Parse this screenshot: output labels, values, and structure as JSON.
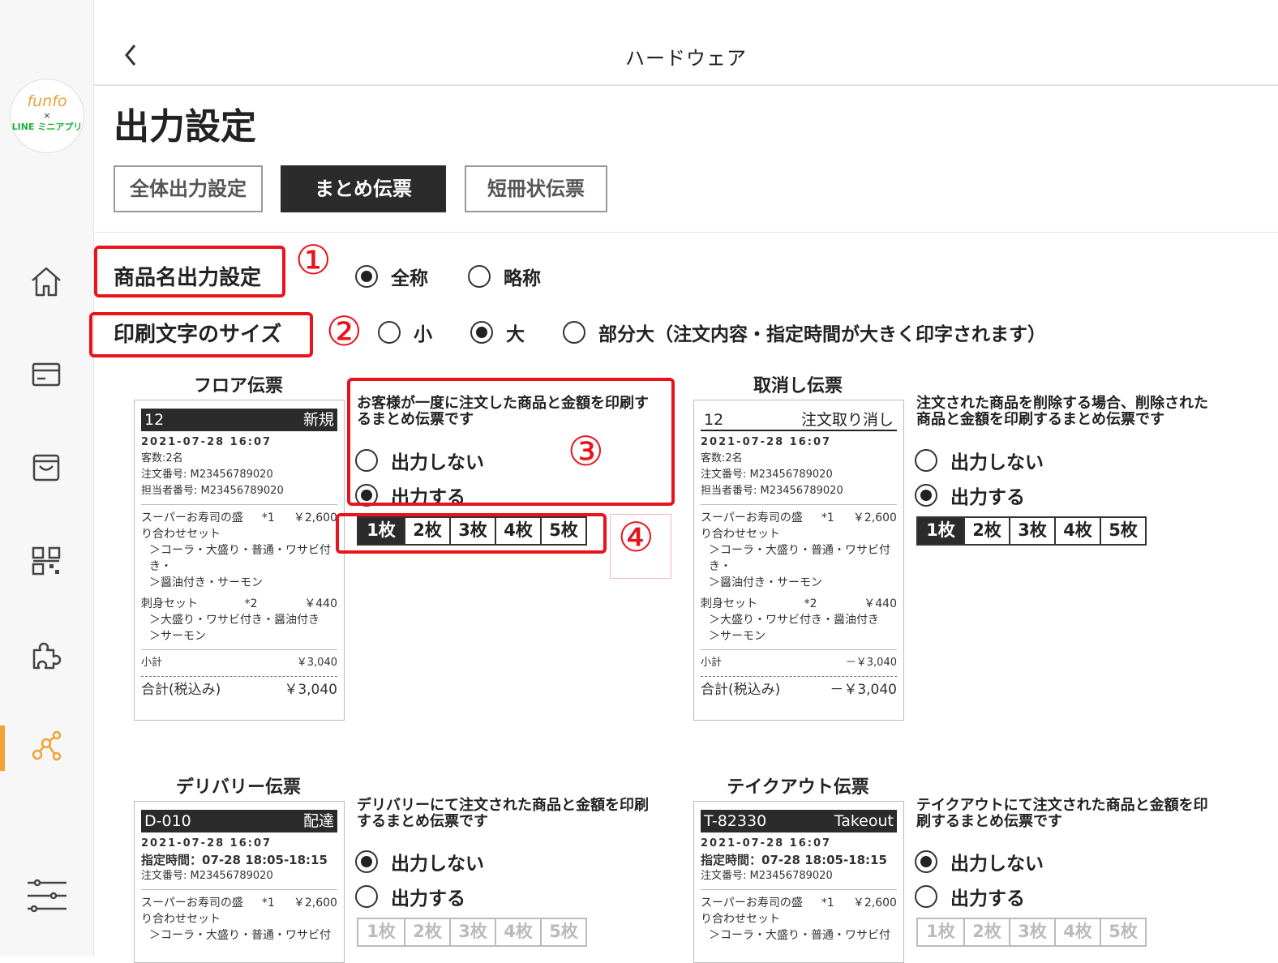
{
  "app": {
    "brand_line1": "funfo",
    "brand_line2": "×",
    "brand_line3": "LINE ミニアプリ"
  },
  "topbar": {
    "back_icon": "chevron-left-icon",
    "title": "ハードウェア"
  },
  "page": {
    "title": "出力設定"
  },
  "tabs": [
    {
      "label": "全体出力設定",
      "active": false
    },
    {
      "label": "まとめ伝票",
      "active": true
    },
    {
      "label": "短冊状伝票",
      "active": false
    }
  ],
  "annotations": {
    "n1": "①",
    "n2": "②",
    "n3": "③",
    "n4": "④",
    "color": "#e8131b"
  },
  "product_name": {
    "label": "商品名出力設定",
    "options": [
      {
        "label": "全称",
        "selected": true
      },
      {
        "label": "略称",
        "selected": false
      }
    ]
  },
  "font_size": {
    "label": "印刷文字のサイズ",
    "options": [
      {
        "label": "小",
        "selected": false
      },
      {
        "label": "大",
        "selected": true
      },
      {
        "label": "部分大（注文内容・指定時間が大きく印字されます）",
        "selected": false
      }
    ]
  },
  "copies": [
    "1枚",
    "2枚",
    "3枚",
    "4枚",
    "5枚"
  ],
  "floor": {
    "title": "フロア伝票",
    "desc_1": "お客様が一度に注文した商品と金額を印刷す",
    "desc_2": "るまとめ伝票です",
    "opt_off": "出力しない",
    "opt_on": "出力する",
    "output": true,
    "copies_selected": "1枚"
  },
  "cancel": {
    "title": "取消し伝票",
    "desc_1": "注文された商品を削除する場合、削除された",
    "desc_2": "商品と金額を印刷するまとめ伝票です",
    "opt_off": "出力しない",
    "opt_on": "出力する",
    "output": true,
    "copies_selected": "1枚"
  },
  "delivery": {
    "title": "デリバリー伝票",
    "desc_1": "デリバリーにて注文された商品と金額を印刷",
    "desc_2": "するまとめ伝票です",
    "opt_off": "出力しない",
    "opt_on": "出力する",
    "output": false
  },
  "takeout": {
    "title": "テイクアウト伝票",
    "desc_1": "テイクアウトにて注文された商品と金額を印",
    "desc_2": "刷するまとめ伝票です",
    "opt_off": "出力しない",
    "opt_on": "出力する",
    "output": false
  },
  "receipt_floor": {
    "no": "12",
    "tag": "新規",
    "date": "2021-07-28 16:07",
    "guests": "客数:2名",
    "order_no": "注文番号: M23456789020",
    "staff_no": "担当者番号: M23456789020",
    "item1_name": "スーパーお寿司の盛",
    "item1_qty": "*1",
    "item1_price": "￥2,600",
    "item1_name2": "り合わせセット",
    "item1_opt1": "＞コーラ・大盛り・普通・ワサビ付",
    "item1_opt1b": "き・",
    "item1_opt2": "＞醤油付き・サーモン",
    "item2_name": "刺身セット",
    "item2_qty": "*2",
    "item2_price": "￥440",
    "item2_opt1": "＞大盛り・ワサビ付き・醤油付き",
    "item2_opt2": "＞サーモン",
    "subtotal_label": "小計",
    "subtotal": "￥3,040",
    "total_label": "合計(税込み)",
    "total": "￥3,040"
  },
  "receipt_cancel": {
    "no": "12",
    "tag": "注文取り消し",
    "date": "2021-07-28 16:07",
    "guests": "客数:2名",
    "order_no": "注文番号: M23456789020",
    "staff_no": "担当者番号: M23456789020",
    "item1_name": "スーパーお寿司の盛",
    "item1_qty": "*1",
    "item1_price": "￥2,600",
    "item1_name2": "り合わせセット",
    "item1_opt1": "＞コーラ・大盛り・普通・ワサビ付",
    "item1_opt1b": "き・",
    "item1_opt2": "＞醤油付き・サーモン",
    "item2_name": "刺身セット",
    "item2_qty": "*2",
    "item2_price": "￥440",
    "item2_opt1": "＞大盛り・ワサビ付き・醤油付き",
    "item2_opt2": "＞サーモン",
    "subtotal_label": "小計",
    "subtotal": "－￥3,040",
    "total_label": "合計(税込み)",
    "total": "－￥3,040"
  },
  "receipt_delivery": {
    "no": "D-010",
    "tag": "配達",
    "date": "2021-07-28 16:07",
    "time": "指定時間：07-28 18:05-18:15",
    "order_no": "注文番号: M23456789020",
    "item1_name": "スーパーお寿司の盛",
    "item1_qty": "*1",
    "item1_price": "￥2,600",
    "item1_name2": "り合わせセット",
    "item1_opt1": "＞コーラ・大盛り・普通・ワサビ付"
  },
  "receipt_takeout": {
    "no": "T-82330",
    "tag": "Takeout",
    "date": "2021-07-28 16:07",
    "time": "指定時間：07-28 18:05-18:15",
    "order_no": "注文番号: M23456789020",
    "item1_name": "スーパーお寿司の盛",
    "item1_qty": "*1",
    "item1_price": "￥2,600",
    "item1_name2": "り合わせセット",
    "item1_opt1": "＞コーラ・大盛り・普通・ワサビ付"
  },
  "nav_icons": [
    "home-icon",
    "card-icon",
    "basket-icon",
    "qr-code-icon",
    "puzzle-icon",
    "network-icon",
    "sliders-icon"
  ]
}
